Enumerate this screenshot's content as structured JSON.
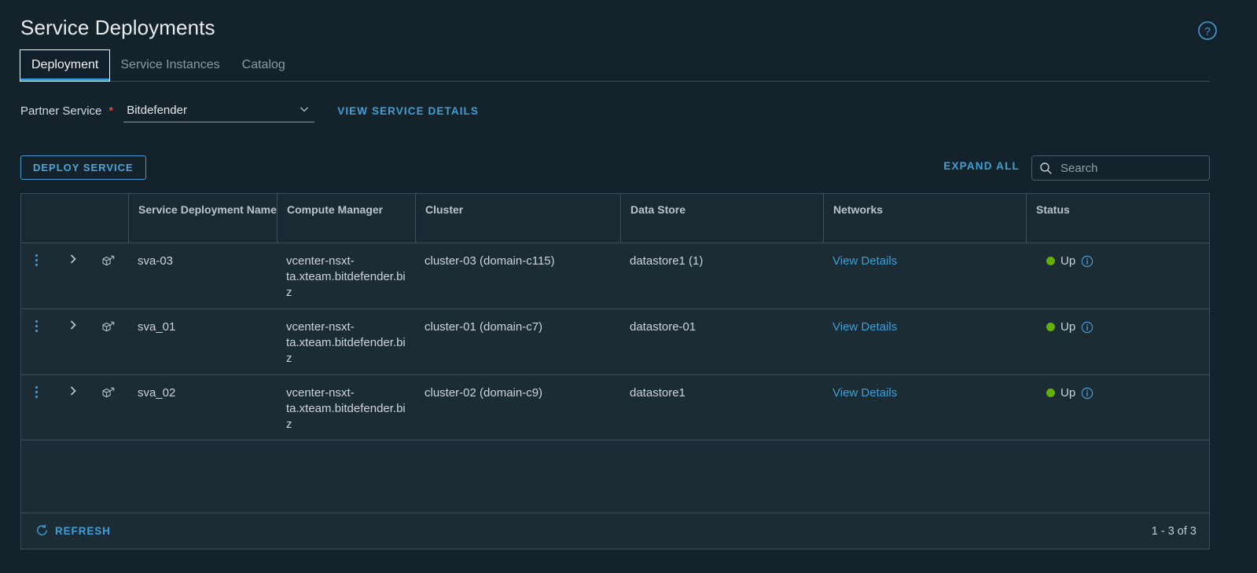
{
  "header": {
    "title": "Service Deployments",
    "help_icon": "help-circle-icon"
  },
  "tabs": [
    {
      "label": "Deployment",
      "active": true
    },
    {
      "label": "Service Instances",
      "active": false
    },
    {
      "label": "Catalog",
      "active": false
    }
  ],
  "filter": {
    "label": "Partner Service",
    "required_marker": "*",
    "selected_value": "Bitdefender",
    "caret_icon": "chevron-down-icon",
    "view_details_link": "VIEW SERVICE DETAILS"
  },
  "toolbar": {
    "deploy_label": "DEPLOY SERVICE",
    "expand_all_label": "EXPAND ALL",
    "search_placeholder": "Search",
    "search_value": "",
    "search_icon": "search-icon"
  },
  "table": {
    "columns": [
      {
        "key": "actions",
        "label": ""
      },
      {
        "key": "expand",
        "label": ""
      },
      {
        "key": "icon",
        "label": ""
      },
      {
        "key": "name",
        "label": "Service Deployment Name"
      },
      {
        "key": "compute_manager",
        "label": "Compute Manager"
      },
      {
        "key": "cluster",
        "label": "Cluster"
      },
      {
        "key": "data_store",
        "label": "Data Store"
      },
      {
        "key": "networks",
        "label": "Networks"
      },
      {
        "key": "status",
        "label": "Status"
      }
    ],
    "rows": [
      {
        "name": "sva-03",
        "compute_manager": "vcenter-nsxt-ta.xteam.bitdefender.biz",
        "cluster": "cluster-03 (domain-c115)",
        "data_store": "datastore1 (1)",
        "networks_link": "View Details",
        "status": "Up",
        "status_color": "#62b100",
        "menu_icon": "kebab-menu-icon",
        "expand_icon": "chevron-right-icon",
        "row_icon": "service-vm-icon",
        "info_icon": "info-circle-icon"
      },
      {
        "name": "sva_01",
        "compute_manager": "vcenter-nsxt-ta.xteam.bitdefender.biz",
        "cluster": "cluster-01 (domain-c7)",
        "data_store": "datastore-01",
        "networks_link": "View Details",
        "status": "Up",
        "status_color": "#62b100",
        "menu_icon": "kebab-menu-icon",
        "expand_icon": "chevron-right-icon",
        "row_icon": "service-vm-icon",
        "info_icon": "info-circle-icon"
      },
      {
        "name": "sva_02",
        "compute_manager": "vcenter-nsxt-ta.xteam.bitdefender.biz",
        "cluster": "cluster-02 (domain-c9)",
        "data_store": "datastore1",
        "networks_link": "View Details",
        "status": "Up",
        "status_color": "#62b100",
        "menu_icon": "kebab-menu-icon",
        "expand_icon": "chevron-right-icon",
        "row_icon": "service-vm-icon",
        "info_icon": "info-circle-icon"
      }
    ]
  },
  "footer": {
    "refresh_label": "REFRESH",
    "refresh_icon": "refresh-icon",
    "pagination": "1 - 3 of 3"
  },
  "colors": {
    "page_bg": "#14232b",
    "card_bg": "#1b2c35",
    "header_bg": "#192a33",
    "border": "#3d5059",
    "accent": "#3f9fd6",
    "status_up": "#62b100",
    "required": "#e8674a"
  }
}
